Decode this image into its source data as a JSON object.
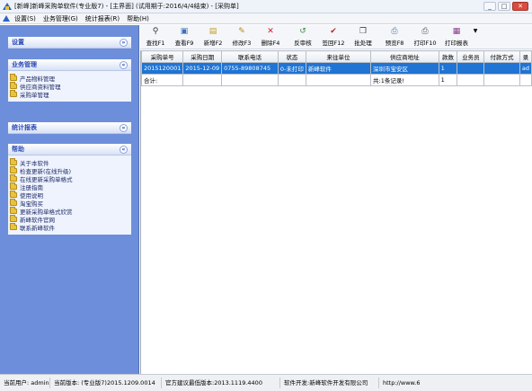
{
  "window": {
    "title": "[新峰]新峰采购单软件(专业版7) - [主界面] (试用期于:2016/4/4结束) - [采购单]",
    "buttons": {
      "minimize": "_",
      "restore": "□",
      "close": "✕"
    }
  },
  "menubar": {
    "items": [
      "设置(S)",
      "业务管理(G)",
      "统计报表(R)",
      "帮助(H)"
    ]
  },
  "sidebar": {
    "panels": [
      {
        "title": "设置",
        "chevron": "»",
        "items": []
      },
      {
        "title": "业务管理",
        "chevron": "«",
        "items": [
          "产品物料管理",
          "供应商资料管理",
          "采购单管理"
        ]
      },
      {
        "title": "统计报表",
        "chevron": "»",
        "items": []
      },
      {
        "title": "帮助",
        "chevron": "«",
        "items": [
          "关于本软件",
          "检查更新(在线升级)",
          "在线更新采购单格式",
          "注册指南",
          "使用说明",
          "淘宝购买",
          "更新采购单格式欣赏",
          "新峰软件官网",
          "联系新峰软件"
        ]
      }
    ]
  },
  "toolbar": {
    "buttons": [
      {
        "label": "查找F1",
        "icon": "binoculars-icon"
      },
      {
        "label": "查看F9",
        "icon": "view-icon"
      },
      {
        "label": "新增F2",
        "icon": "new-document-icon"
      },
      {
        "label": "修改F3",
        "icon": "edit-icon"
      },
      {
        "label": "删除F4",
        "icon": "delete-icon"
      },
      {
        "label": "反审核",
        "icon": "unaudit-icon"
      },
      {
        "label": "签回F12",
        "icon": "check-icon"
      },
      {
        "label": "批处理",
        "icon": "batch-icon"
      },
      {
        "label": "预览F8",
        "icon": "preview-icon"
      },
      {
        "label": "打印F10",
        "icon": "print-icon"
      },
      {
        "label": "打印报表",
        "icon": "print-report-icon"
      }
    ],
    "dropdown_arrow": "▼"
  },
  "table": {
    "columns": [
      "采购单号",
      "采购日期",
      "联系电话",
      "状态",
      "来往单位",
      "供应商地址",
      "款数",
      "业务员",
      "付款方式",
      "录"
    ],
    "rows": [
      [
        "2015120001",
        "2015-12-09",
        "0755-89808745",
        "0-未打印",
        "新峰软件",
        "深圳市宝安区",
        "1",
        "",
        "",
        "ad"
      ]
    ],
    "summary": [
      "合计:",
      "",
      "",
      "",
      "",
      "共:1条记录!",
      "1",
      "",
      "",
      ""
    ]
  },
  "statusbar": {
    "items": [
      "当前用户: admin",
      "当前版本: (专业版7)2015.1209.0014",
      "官方建议最低版本:2013.1119.4400",
      "软件开发:新峰软件开发有限公司",
      "http://www.6"
    ]
  },
  "colors": {
    "sidebar_bg": "#6d8fdb",
    "selection": "#1f74d4",
    "panel_title": "#2b49b6"
  }
}
